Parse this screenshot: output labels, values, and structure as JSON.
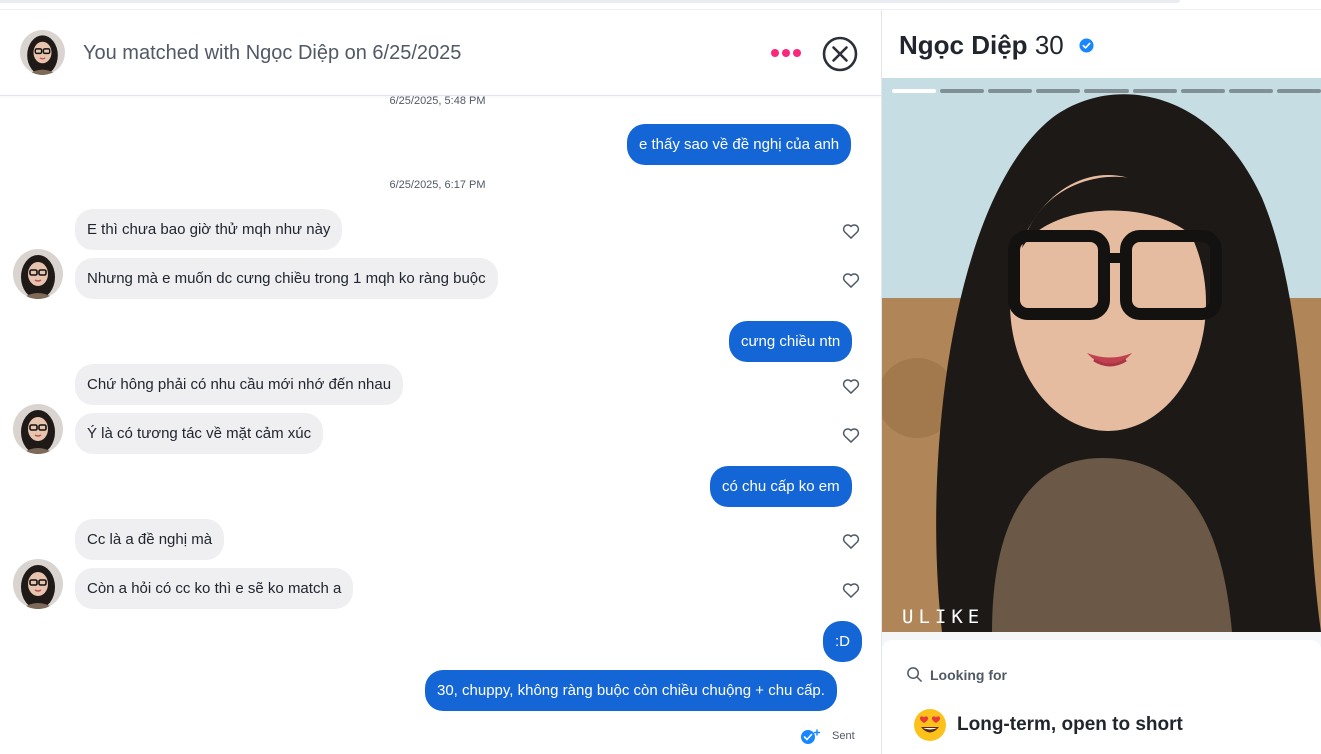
{
  "header": {
    "title": "You matched with Ngọc Diệp on 6/25/2025",
    "more_icon": "more-dots-icon",
    "close_icon": "close-circle-icon"
  },
  "messages": {
    "timestamps": [
      "6/25/2025, 5:48 PM",
      "6/25/2025, 6:17 PM"
    ],
    "items": [
      {
        "side": "out",
        "text": "e thấy sao về đề nghị của anh"
      },
      {
        "side": "in",
        "text": "E thì chưa bao giờ thử mqh như này"
      },
      {
        "side": "in",
        "text": "Nhưng mà e muốn dc cưng chiều trong 1 mqh ko ràng buộc"
      },
      {
        "side": "out",
        "text": "cưng chiều ntn"
      },
      {
        "side": "in",
        "text": "Chứ hông phải có nhu cầu mới nhớ đến nhau"
      },
      {
        "side": "in",
        "text": "Ý là có tương tác về mặt cảm xúc"
      },
      {
        "side": "out",
        "text": "có chu cấp ko em"
      },
      {
        "side": "in",
        "text": "Cc là a đề nghị mà"
      },
      {
        "side": "in",
        "text": "Còn a hỏi có cc ko thì e sẽ ko match a"
      },
      {
        "side": "out",
        "text": ":D"
      },
      {
        "side": "out",
        "text": "30,  chuppy, không ràng buộc còn chiều chuộng + chu cấp."
      }
    ],
    "status": "Sent"
  },
  "profile": {
    "name": "Ngọc Diệp",
    "age": "30",
    "verified_icon": "verified-badge-icon",
    "photo_count": 9,
    "active_photo": 1,
    "photo_watermark": "ULIKE",
    "looking_for_label": "Looking for",
    "looking_for_value": "Long-term, open to short",
    "looking_for_icon": "heart-eyes-emoji-icon"
  },
  "colors": {
    "accent": "#fd267d",
    "outgoing_bubble": "#1466d6",
    "incoming_bubble": "#efeff2",
    "verified": "#1786ff"
  }
}
